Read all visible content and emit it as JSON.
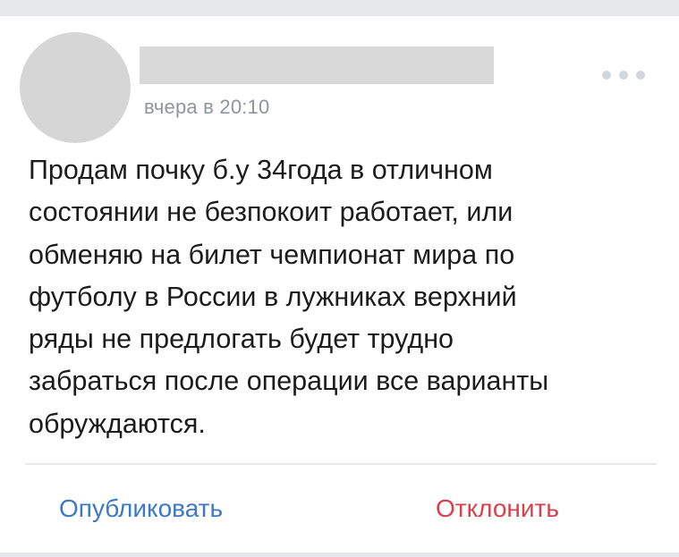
{
  "post": {
    "timestamp": "вчера в 20:10",
    "text": "Продам почку б.у 34года в отличном\nсостоянии не безпокоит работает, или\nобменяю на билет чемпионат мира по\nфутболу в России в лужниках верхний\nряды не предлогать будет трудно\nзабраться после операции все варианты\nобруждаются."
  },
  "actions": {
    "publish_label": "Опубликовать",
    "reject_label": "Отклонить"
  },
  "icons": {
    "more": "more-horizontal-icon"
  },
  "colors": {
    "publish": "#3d79c6",
    "reject": "#d8414b",
    "timestamp": "#8e959d"
  }
}
